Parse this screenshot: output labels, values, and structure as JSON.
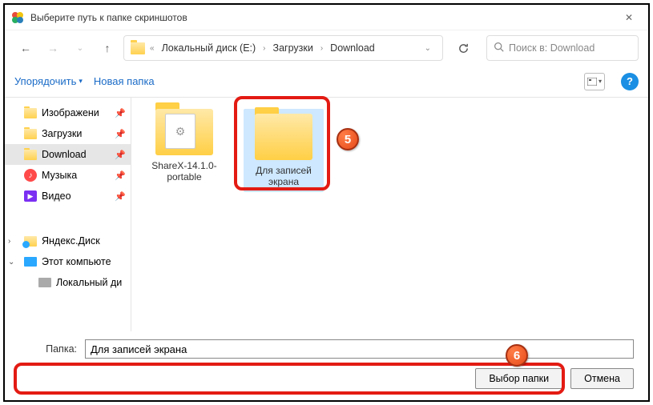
{
  "window": {
    "title": "Выберите путь к папке скриншотов"
  },
  "address": {
    "crumbs": [
      "Локальный диск (E:)",
      "Загрузки",
      "Download"
    ],
    "search_placeholder": "Поиск в: Download"
  },
  "toolbar": {
    "organize": "Упорядочить",
    "new_folder": "Новая папка"
  },
  "sidebar": {
    "items": [
      {
        "label": "Изображени",
        "icon": "folder",
        "pinned": true
      },
      {
        "label": "Загрузки",
        "icon": "folder",
        "pinned": true
      },
      {
        "label": "Download",
        "icon": "folder",
        "pinned": true,
        "selected": true
      },
      {
        "label": "Музыка",
        "icon": "music",
        "pinned": true
      },
      {
        "label": "Видео",
        "icon": "video",
        "pinned": true
      }
    ],
    "items2": [
      {
        "label": "Яндекс.Диск",
        "icon": "yd",
        "expandable": true
      },
      {
        "label": "Этот компьюте",
        "icon": "pc",
        "expandable": true,
        "expanded": true
      },
      {
        "label": "Локальный ди",
        "icon": "disk",
        "indent": true
      }
    ]
  },
  "content": {
    "items": [
      {
        "name": "ShareX-14.1.0-portable",
        "has_doc": true
      },
      {
        "name": "Для записей экрана",
        "selected": true
      }
    ]
  },
  "footer": {
    "label": "Папка:",
    "value": "Для записей экрана",
    "select": "Выбор папки",
    "cancel": "Отмена"
  },
  "badges": {
    "b5": "5",
    "b6": "6"
  }
}
